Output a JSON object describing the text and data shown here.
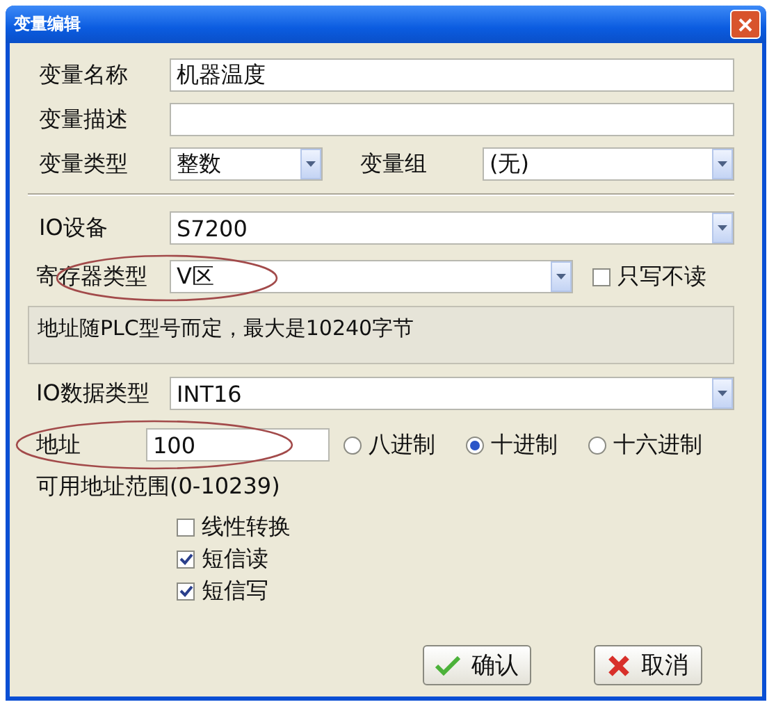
{
  "window": {
    "title": "变量编辑"
  },
  "fields": [
    {
      "label": "变量名称",
      "value": "机器温度"
    },
    {
      "label": "变量描述"
    }
  ],
  "type_row": {
    "label": "变量类型",
    "value": "整数",
    "group_label": "变量组",
    "group_value": "(无)"
  },
  "io_device": {
    "label": "IO设备",
    "value": "S7200"
  },
  "register": {
    "label": "寄存器类型",
    "value": "V区",
    "write_only": {
      "label": "只写不读",
      "checked": false
    }
  },
  "info": "地址随PLC型号而定，最大是10240字节",
  "io_data_type": {
    "label": "IO数据类型",
    "value": "INT16"
  },
  "address": {
    "label": "地址",
    "value": "100",
    "radios": [
      {
        "label": "八进制",
        "selected": false
      },
      {
        "label": "十进制",
        "selected": true
      },
      {
        "label": "十六进制",
        "selected": false
      }
    ]
  },
  "range": "可用地址范围(0-10239)",
  "options": [
    {
      "label": "线性转换",
      "checked": false
    },
    {
      "label": "短信读",
      "checked": true
    },
    {
      "label": "短信写",
      "checked": true
    }
  ],
  "buttons": [
    {
      "kind": "ok",
      "label": "确认"
    },
    {
      "kind": "cancel",
      "label": "取消"
    }
  ]
}
